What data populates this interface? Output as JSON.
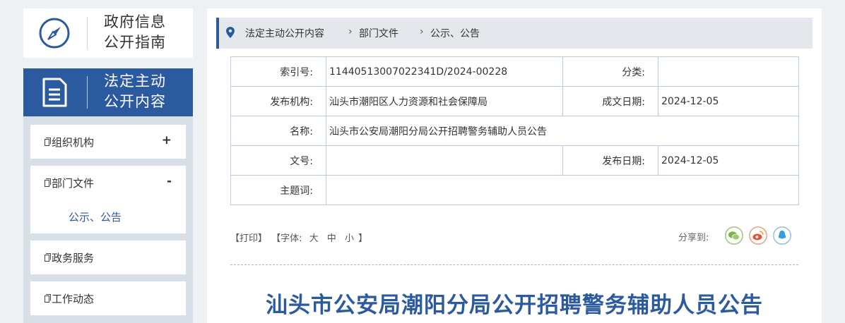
{
  "left": {
    "guide_title_line1": "政府信息",
    "guide_title_line2": "公开指南",
    "section_title_line1": "法定主动",
    "section_title_line2": "公开内容",
    "nav": [
      {
        "label": "组织机构",
        "toggle": "+"
      },
      {
        "label": "部门文件",
        "toggle": "-",
        "sub": "公示、公告"
      },
      {
        "label": "政务服务"
      },
      {
        "label": "工作动态"
      }
    ]
  },
  "breadcrumb": [
    "法定主动公开内容",
    "部门文件",
    "公示、公告"
  ],
  "meta": {
    "index_label": "索引号:",
    "index_value": "11440513007022341D/2024-00228",
    "category_label": "分类:",
    "category_value": "",
    "publisher_label": "发布机构:",
    "publisher_value": "汕头市潮阳区人力资源和社会保障局",
    "created_label": "成文日期:",
    "created_value": "2024-12-05",
    "name_label": "名称:",
    "name_value": "汕头市公安局潮阳分局公开招聘警务辅助人员公告",
    "docno_label": "文号:",
    "docno_value": "",
    "pubdate_label": "发布日期:",
    "pubdate_value": "2024-12-05",
    "keywords_label": "主题词:",
    "keywords_value": ""
  },
  "tools": {
    "print": "【打印】",
    "font_prefix": "【字体:",
    "font_large": "大",
    "font_medium": "中",
    "font_small": "小",
    "font_suffix": "】"
  },
  "share": {
    "label": "分享到:",
    "icons": [
      "wechat-icon",
      "weibo-icon",
      "qq-icon"
    ]
  },
  "article_title": "汕头市公安局潮阳分局公开招聘警务辅助人员公告",
  "colors": {
    "brand_blue": "#2b5a9e",
    "panel_bg": "#d8dfe6",
    "page_bg": "#eef1f4"
  }
}
